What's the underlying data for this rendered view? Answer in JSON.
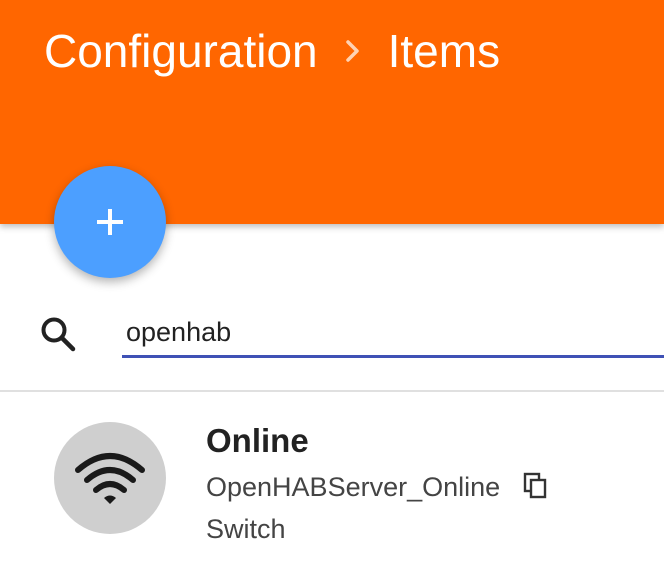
{
  "colors": {
    "header_bg": "#ff6600",
    "fab_bg": "#4c9fff",
    "input_underline": "#3f51b5",
    "avatar_bg": "#cfcfcf"
  },
  "header": {
    "breadcrumb": {
      "root": "Configuration",
      "separator_icon": "chevron-right-icon",
      "current": "Items"
    }
  },
  "fab": {
    "icon": "plus-icon"
  },
  "search": {
    "icon": "search-icon",
    "value": "openhab"
  },
  "items": [
    {
      "icon": "wifi-icon",
      "label": "Online",
      "name": "OpenHABServer_Online",
      "copy_icon": "copy-icon",
      "type": "Switch"
    }
  ]
}
